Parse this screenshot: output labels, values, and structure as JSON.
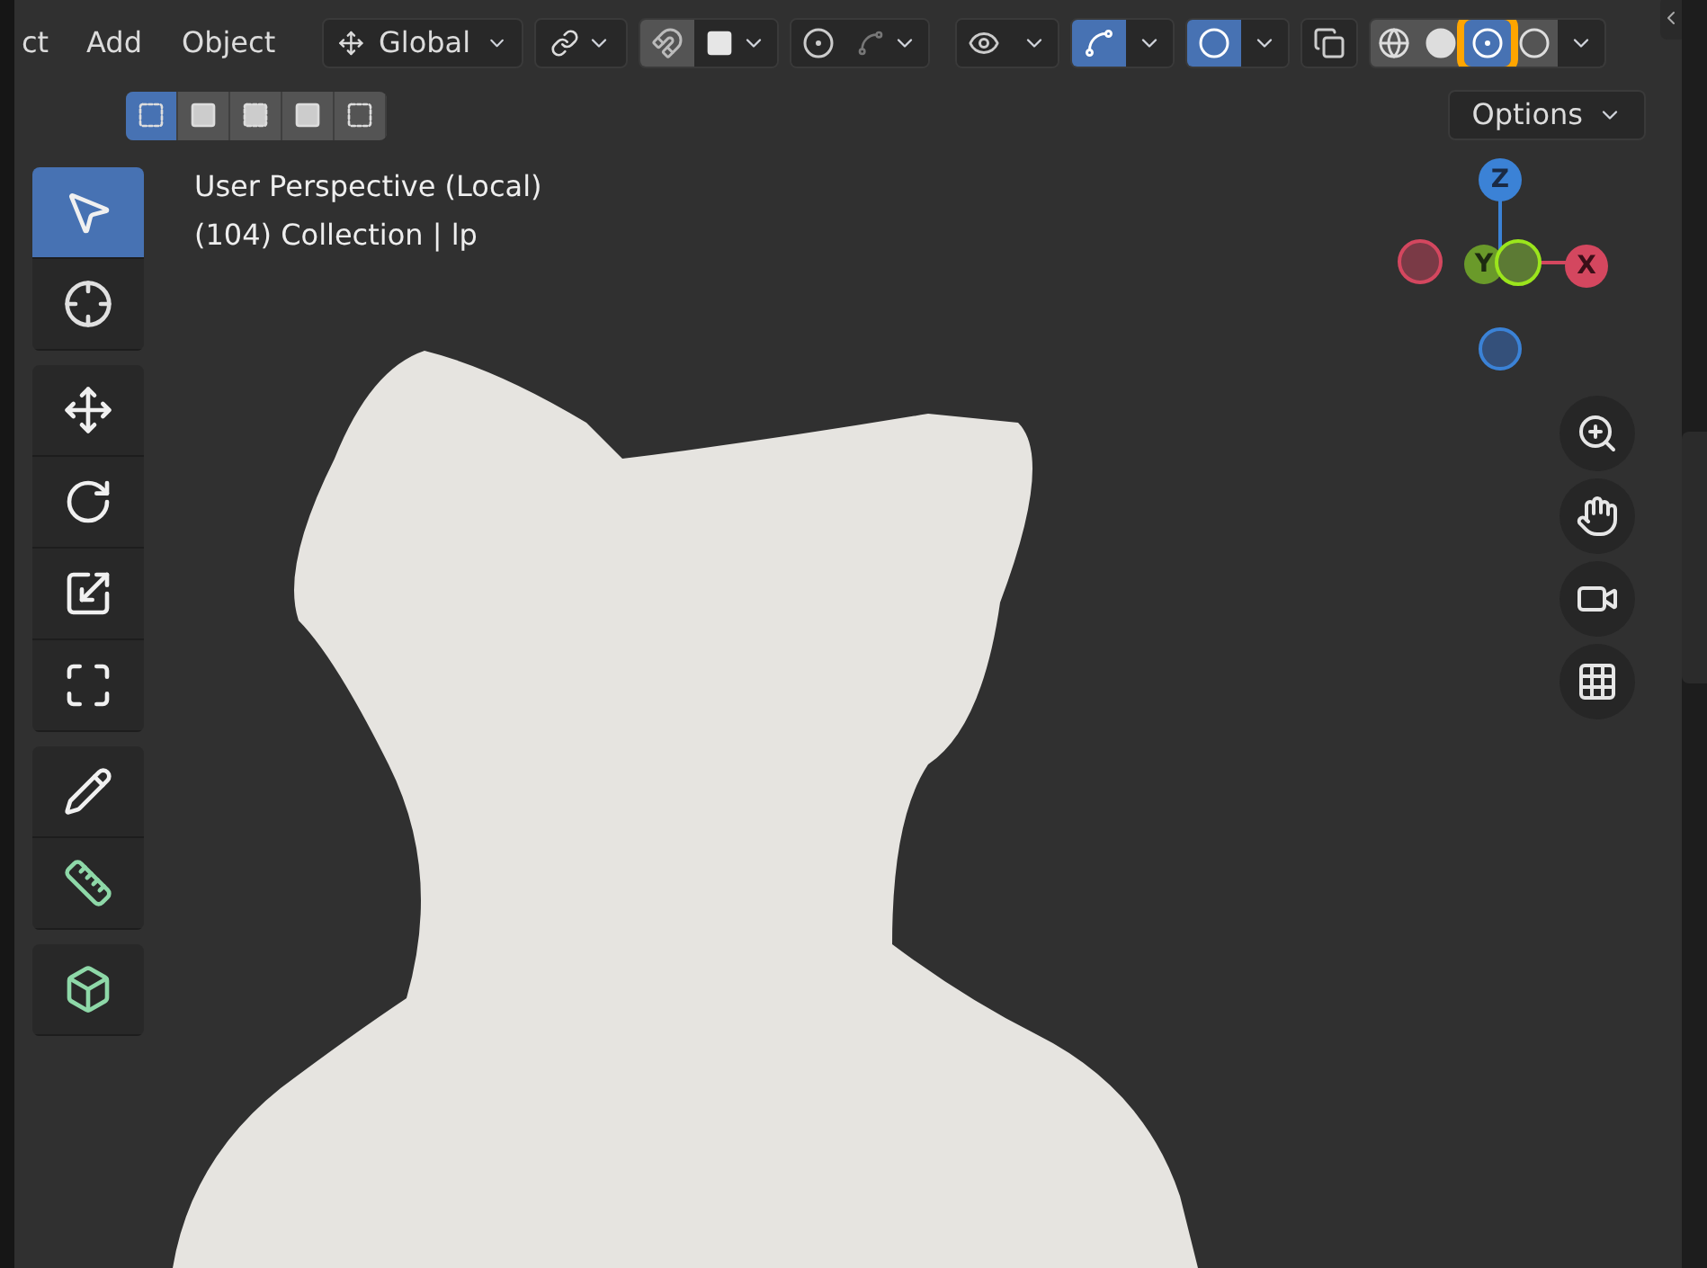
{
  "menu": [
    "ct",
    "Add",
    "Object"
  ],
  "orientation": {
    "value": "Global"
  },
  "header_toggles": [
    {
      "kind": "snap",
      "on": false
    },
    {
      "kind": "proportional",
      "on": false
    },
    {
      "kind": "visibility",
      "on": false
    },
    {
      "kind": "gizmo",
      "on": true
    },
    {
      "kind": "overlay",
      "on": true
    },
    {
      "kind": "xray",
      "on": false
    }
  ],
  "shading_modes": [
    {
      "kind": "wireframe",
      "selected": false
    },
    {
      "kind": "solid",
      "selected": false
    },
    {
      "kind": "material",
      "selected": true
    },
    {
      "kind": "rendered",
      "selected": false
    }
  ],
  "select_modes": [
    {
      "kind": "new",
      "selected": true
    },
    {
      "kind": "extend",
      "selected": false
    },
    {
      "kind": "subtract",
      "selected": false
    },
    {
      "kind": "invert",
      "selected": false
    },
    {
      "kind": "intersect",
      "selected": false
    }
  ],
  "options_button": "Options",
  "viewport_info": [
    "User Perspective (Local)",
    "(104) Collection | lp"
  ],
  "tool_groups": [
    [
      {
        "kind": "select",
        "selected": true
      },
      {
        "kind": "cursor",
        "selected": false
      }
    ],
    [
      {
        "kind": "move",
        "selected": false
      },
      {
        "kind": "rotate",
        "selected": false
      },
      {
        "kind": "scale",
        "selected": false
      },
      {
        "kind": "transform",
        "selected": false
      }
    ],
    [
      {
        "kind": "annotate",
        "selected": false
      },
      {
        "kind": "measure",
        "selected": false
      }
    ],
    [
      {
        "kind": "add_cube",
        "selected": false
      }
    ]
  ],
  "axis_gizmo": {
    "z": "Z",
    "y": "Y",
    "x": "X"
  }
}
